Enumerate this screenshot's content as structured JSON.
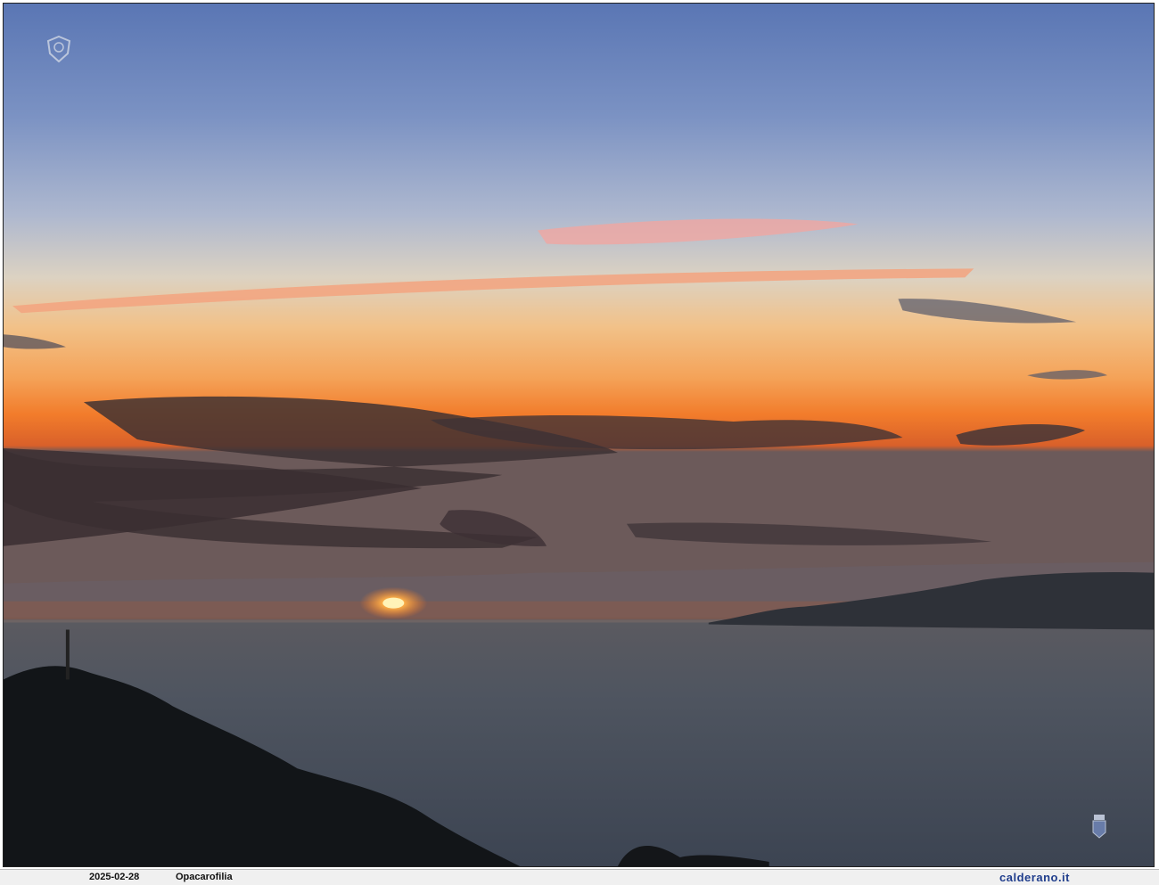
{
  "caption": {
    "date": "2025-02-28",
    "title": "Opacarofilia",
    "site": "calderano.it"
  },
  "scene": {
    "description_icons": [
      "sunset-photo",
      "sun-icon",
      "headland-silhouette",
      "logo-icon",
      "crest-icon"
    ],
    "colors": {
      "sky_top": "#5b78b6",
      "sky_mid": "#b9c1cf",
      "sky_glow": "#f4a85a",
      "horizon": "#f06a1e",
      "sea": "#4e5561",
      "land": "#15181c"
    }
  }
}
